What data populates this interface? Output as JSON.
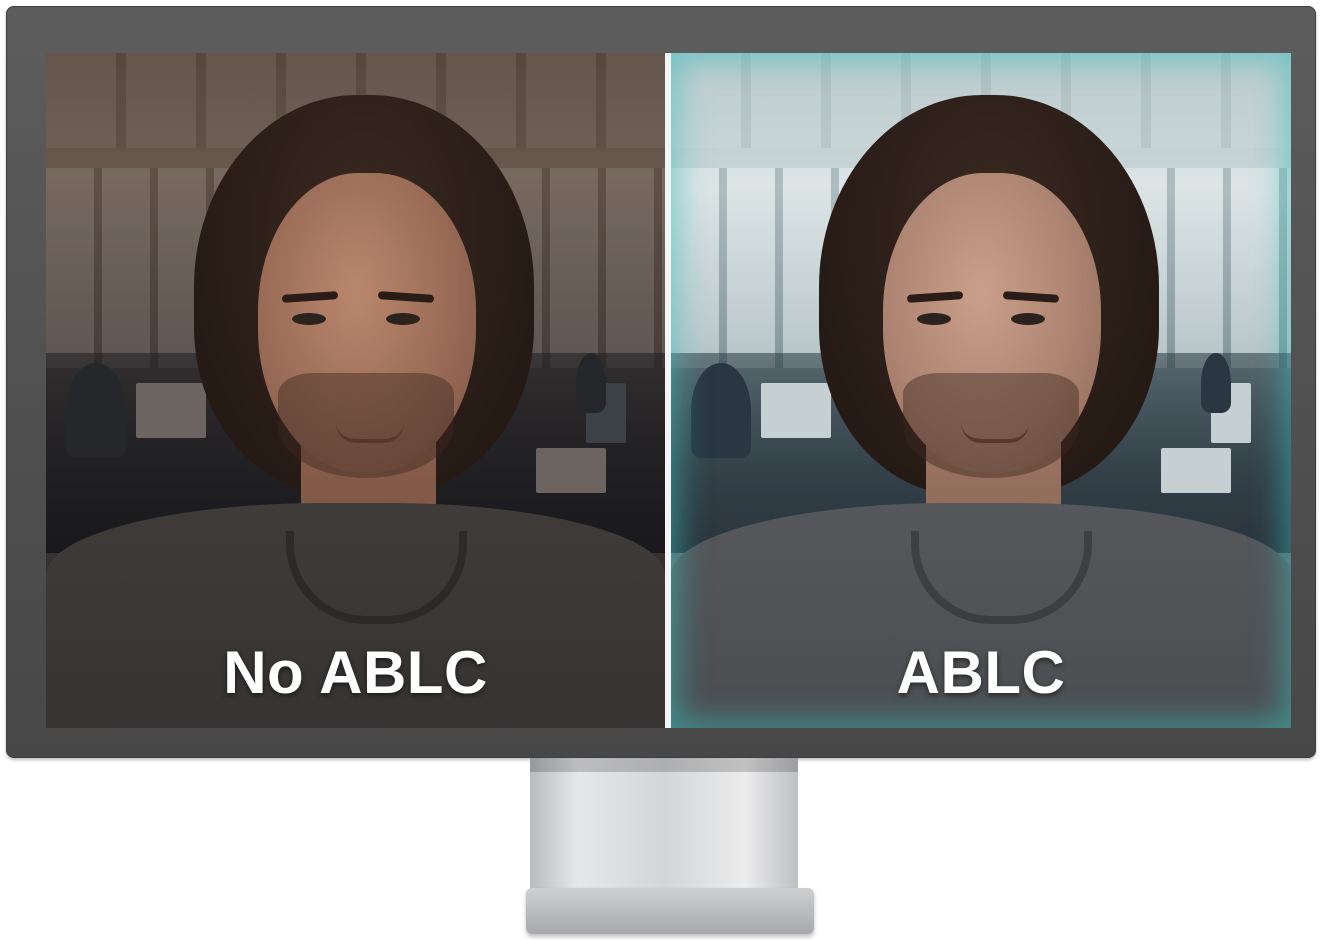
{
  "comparison": {
    "left_label": "No ABLC",
    "right_label": "ABLC"
  },
  "colors": {
    "bezel": "#4f4f4f",
    "divider": "#f4f4f4",
    "label_text": "#ffffff",
    "right_panel_tint": "#3cbebe",
    "stand": "#d4d5d7"
  },
  "icons": {
    "device": "monitor"
  }
}
